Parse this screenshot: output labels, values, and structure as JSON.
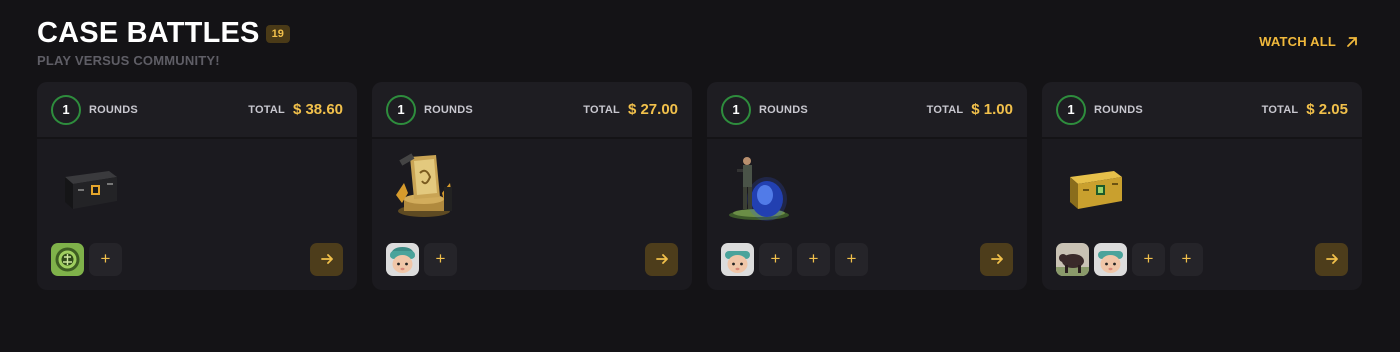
{
  "header": {
    "title": "CASE BATTLES",
    "count": "19",
    "subtitle": "PLAY VERSUS COMMUNITY!",
    "watch_all": "WATCH ALL"
  },
  "colors": {
    "accent": "#f1b93c",
    "round_ring": "#2e8d3d",
    "card_bg": "#1b1a1f",
    "page_bg": "#141316"
  },
  "battles": [
    {
      "rounds": "1",
      "rounds_label": "ROUNDS",
      "total_label": "TOTAL",
      "total": "$ 38.60",
      "case_icon": "black-weapon-case-icon",
      "players": [
        "green-emblem-avatar"
      ],
      "open_slots": 1
    },
    {
      "rounds": "1",
      "rounds_label": "ROUNDS",
      "total_label": "TOTAL",
      "total": "$ 27.00",
      "case_icon": "golden-card-trophy-icon",
      "players": [
        "child-avatar"
      ],
      "open_slots": 1
    },
    {
      "rounds": "1",
      "rounds_label": "ROUNDS",
      "total_label": "TOTAL",
      "total": "$ 1.00",
      "case_icon": "soldier-egg-icon",
      "players": [
        "child-avatar"
      ],
      "open_slots": 3
    },
    {
      "rounds": "1",
      "rounds_label": "ROUNDS",
      "total_label": "TOTAL",
      "total": "$ 2.05",
      "case_icon": "yellow-weapon-case-icon",
      "players": [
        "bull-avatar",
        "child-avatar"
      ],
      "open_slots": 2
    }
  ]
}
